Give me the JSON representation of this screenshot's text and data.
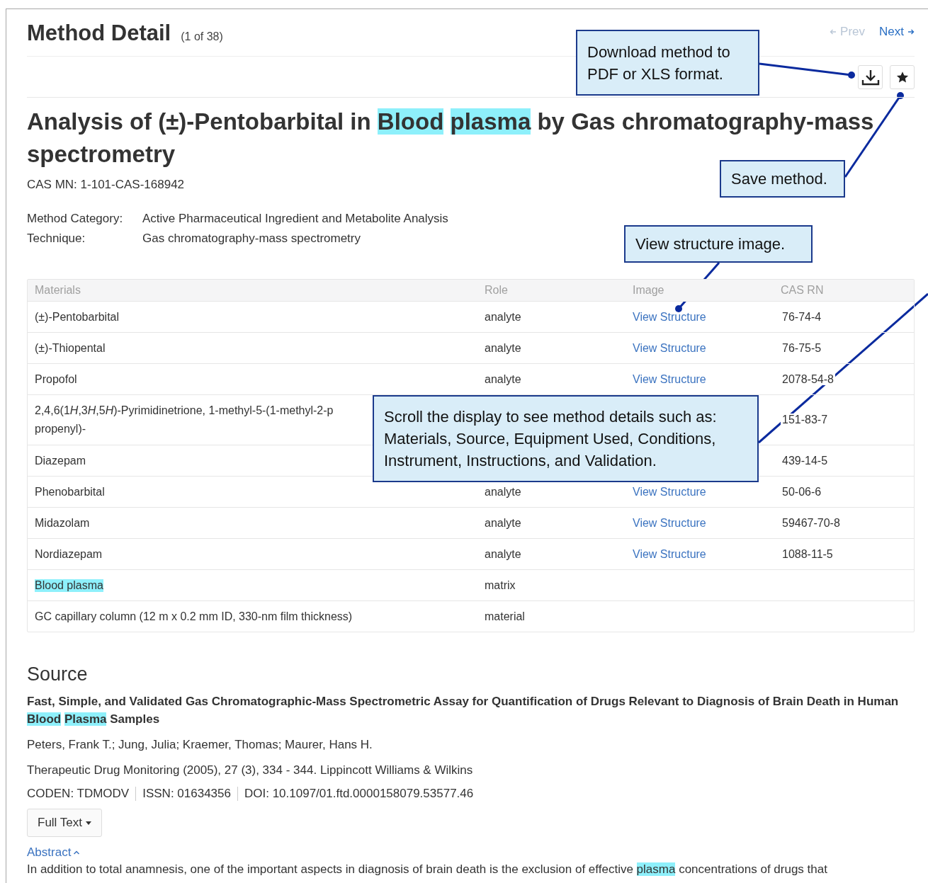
{
  "header": {
    "title": "Method Detail",
    "counter": "(1 of 38)",
    "nav": [
      {
        "label": "Prev",
        "kind": "prev",
        "disabled": true
      },
      {
        "label": "Next",
        "kind": "next",
        "disabled": false
      }
    ]
  },
  "method": {
    "title": [
      {
        "text": "Analysis of (±)-Pentobarbital in ",
        "highlight": false
      },
      {
        "text": "Blood",
        "highlight": true
      },
      {
        "text": "plasma",
        "highlight": true
      },
      {
        "text": " by Gas chromatography-mass spectrometry",
        "highlight": false
      }
    ],
    "cas_mn": "CAS MN: 1-101-CAS-168942",
    "fields": [
      {
        "label": "Method Category:",
        "value": "Active Pharmaceutical Ingredient and Metabolite Analysis"
      },
      {
        "label": "Technique:",
        "value": "Gas chromatography-mass spectrometry"
      }
    ]
  },
  "materials": {
    "columns": [
      "Materials",
      "Role",
      "Image",
      "CAS RN"
    ],
    "rows": [
      {
        "material": [
          [
            {
              "text": "(±)-Pentobarbital",
              "italic": false
            }
          ]
        ],
        "highlight": false,
        "role": "analyte",
        "image": "View Structure",
        "cas_rn": "76-74-4"
      },
      {
        "material": [
          [
            {
              "text": "(±)-Thiopental",
              "italic": false
            }
          ]
        ],
        "highlight": false,
        "role": "analyte",
        "image": "View Structure",
        "cas_rn": "76-75-5"
      },
      {
        "material": [
          [
            {
              "text": "Propofol",
              "italic": false
            }
          ]
        ],
        "highlight": false,
        "role": "analyte",
        "image": "View Structure",
        "cas_rn": "2078-54-8"
      },
      {
        "material": [
          [
            {
              "text": "2,4,6(1",
              "italic": false
            },
            {
              "text": "H",
              "italic": true
            },
            {
              "text": ",3",
              "italic": false
            },
            {
              "text": "H",
              "italic": true
            },
            {
              "text": ",5",
              "italic": false
            },
            {
              "text": "H",
              "italic": true
            },
            {
              "text": ")-Pyrimidinetrione, 1-methyl-5-(1-methyl-2-p",
              "italic": false
            }
          ],
          [
            {
              "text": "propenyl)-",
              "italic": false
            }
          ]
        ],
        "highlight": false,
        "cas_rn": "151-83-7"
      },
      {
        "material": [
          [
            {
              "text": "Diazepam",
              "italic": false
            }
          ]
        ],
        "highlight": false,
        "cas_rn": "439-14-5"
      },
      {
        "material": [
          [
            {
              "text": "Phenobarbital",
              "italic": false
            }
          ]
        ],
        "highlight": false,
        "role": "analyte",
        "image": "View Structure",
        "cas_rn": "50-06-6"
      },
      {
        "material": [
          [
            {
              "text": "Midazolam",
              "italic": false
            }
          ]
        ],
        "highlight": false,
        "role": "analyte",
        "image": "View Structure",
        "cas_rn": "59467-70-8"
      },
      {
        "material": [
          [
            {
              "text": "Nordiazepam",
              "italic": false
            }
          ]
        ],
        "highlight": false,
        "role": "analyte",
        "image": "View Structure",
        "cas_rn": "1088-11-5"
      },
      {
        "material": [
          [
            {
              "text": "Blood plasma",
              "italic": false
            }
          ]
        ],
        "highlight": true,
        "role": "matrix"
      },
      {
        "material": [
          [
            {
              "text": "GC capillary column (12 m x 0.2 mm ID, 330-nm film thickness)",
              "italic": false
            }
          ]
        ],
        "highlight": false,
        "role": "material"
      }
    ]
  },
  "source": {
    "heading": "Source",
    "title": [
      {
        "text": "Fast, Simple, and Validated Gas Chromatographic-Mass Spectrometric Assay for Quantification of Drugs Relevant to Diagnosis of Brain Death in Human ",
        "highlight": false
      },
      {
        "text": "Blood",
        "highlight": true
      },
      {
        "text": "Plasma",
        "highlight": true
      },
      {
        "text": " Samples",
        "highlight": false
      }
    ],
    "authors": "Peters, Frank T.; Jung, Julia; Kraemer, Thomas; Maurer, Hans H.",
    "journal": "Therapeutic Drug Monitoring (2005), 27 (3), 334 - 344. Lippincott Williams & Wilkins",
    "identifiers": [
      "CODEN: TDMODV",
      "ISSN: 01634356",
      "DOI: 10.1097/01.ftd.0000158079.53577.46"
    ],
    "full_text_button": "Full Text",
    "abstract_toggle": "Abstract",
    "abstract_expanded": true,
    "abstract": [
      {
        "text": "In addition to total anamnesis, one of the important aspects in diagnosis of brain death is the exclusion of effective ",
        "highlight": false
      },
      {
        "text": "plasma",
        "highlight": true
      },
      {
        "text": " concentrations of drugs that",
        "highlight": false
      }
    ]
  },
  "callouts": [
    {
      "text": "Download method to PDF or XLS format."
    },
    {
      "text": "Save method."
    },
    {
      "text": "View structure image."
    },
    {
      "text": "Scroll the display to see method details such as: Materials, Source, Equipment Used, Conditions, Instrument, Instructions, and Validation."
    }
  ]
}
